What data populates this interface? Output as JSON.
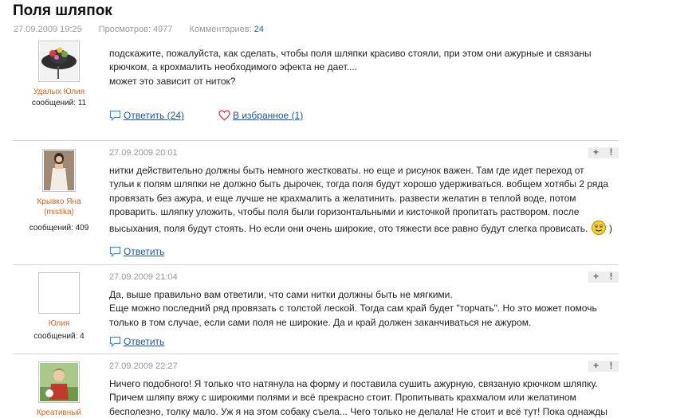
{
  "page": {
    "title": "Поля шляпок",
    "date": "27.09.2009 19:25",
    "views": "Просмотров: 4977",
    "comments_label": "Комментариев:",
    "comments_count": "24"
  },
  "colors": {
    "link": "#1a56a8",
    "author": "#d8641c",
    "meta": "#9a9a9a"
  },
  "post": {
    "author": "Удалых Юлия",
    "messages": "сообщений: 11",
    "lines": [
      "подскажите, пожалуйста, как сделать, чтобы поля шляпки красиво стояли, при этом они ажурные и связаны",
      "крючком, а крохмалить необходимого эфекта не дает....",
      "может это зависит от ниток?"
    ],
    "reply_label": "Ответить (24)",
    "fav_label": "В избранное (1)"
  },
  "comments": [
    {
      "author": "Крывко Яна",
      "author_sub": "(mistika)",
      "messages": "сообщений: 409",
      "date": "27.09.2009 20:01",
      "lines": [
        "нитки действительно должны быть немного жестковаты. но еще и рисунок важен. Там где идет переход от",
        "тульи к полям шляпки не должно быть дырочек, тогда поля будут хорошо удерживаться. вобщем хотябы 2 ряда",
        "провязать без ажура, и еще лучше не крахмалить а желатинить. развести желатин в теплой воде, потом",
        "проварить. шляпку уложить, чтобы поля были горизонтальными и кисточкой пропитать раствором. после",
        "высыхания, поля будут стоять. Но если они очень широкие, ото тяжести все равно будут слегка провисать."
      ],
      "tail": ")",
      "reply_label": "Ответить"
    },
    {
      "author": "Юлия",
      "messages": "сообщений: 4",
      "date": "27.09.2009 21:04",
      "lines": [
        "Да, выше правильно вам ответили, что сами нитки должны быть не мягкими.",
        "Еще можно последний ряд провязать с толстой леской. Тогда сам край будет \"торчать\". Но это может помочь",
        "только в том случае, если сами поля не широкие. Да и край должен заканчиваться не ажуром."
      ],
      "reply_label": "Ответить"
    },
    {
      "author": "Креативный",
      "date": "27.09.2009 22:27",
      "lines": [
        "Ничего подобного! Я только что натянула на форму и поставила сушить ажурную, связаную крючком шляпку.",
        "Причем шляпу вяжу с широкими полями и всё прекрасно стоит. Пропитывать крахмалом или желатином",
        "бесполезно, толку мало. Уж я на этом собаку съела... Чего только не делала! Не стоит и всё тут! Пока однажды"
      ]
    }
  ],
  "actions": {
    "plus": "+",
    "report": "!"
  },
  "icons": [
    "reply-bubble-icon",
    "heart-icon",
    "smiley-icon",
    "plus-icon",
    "report-icon"
  ]
}
